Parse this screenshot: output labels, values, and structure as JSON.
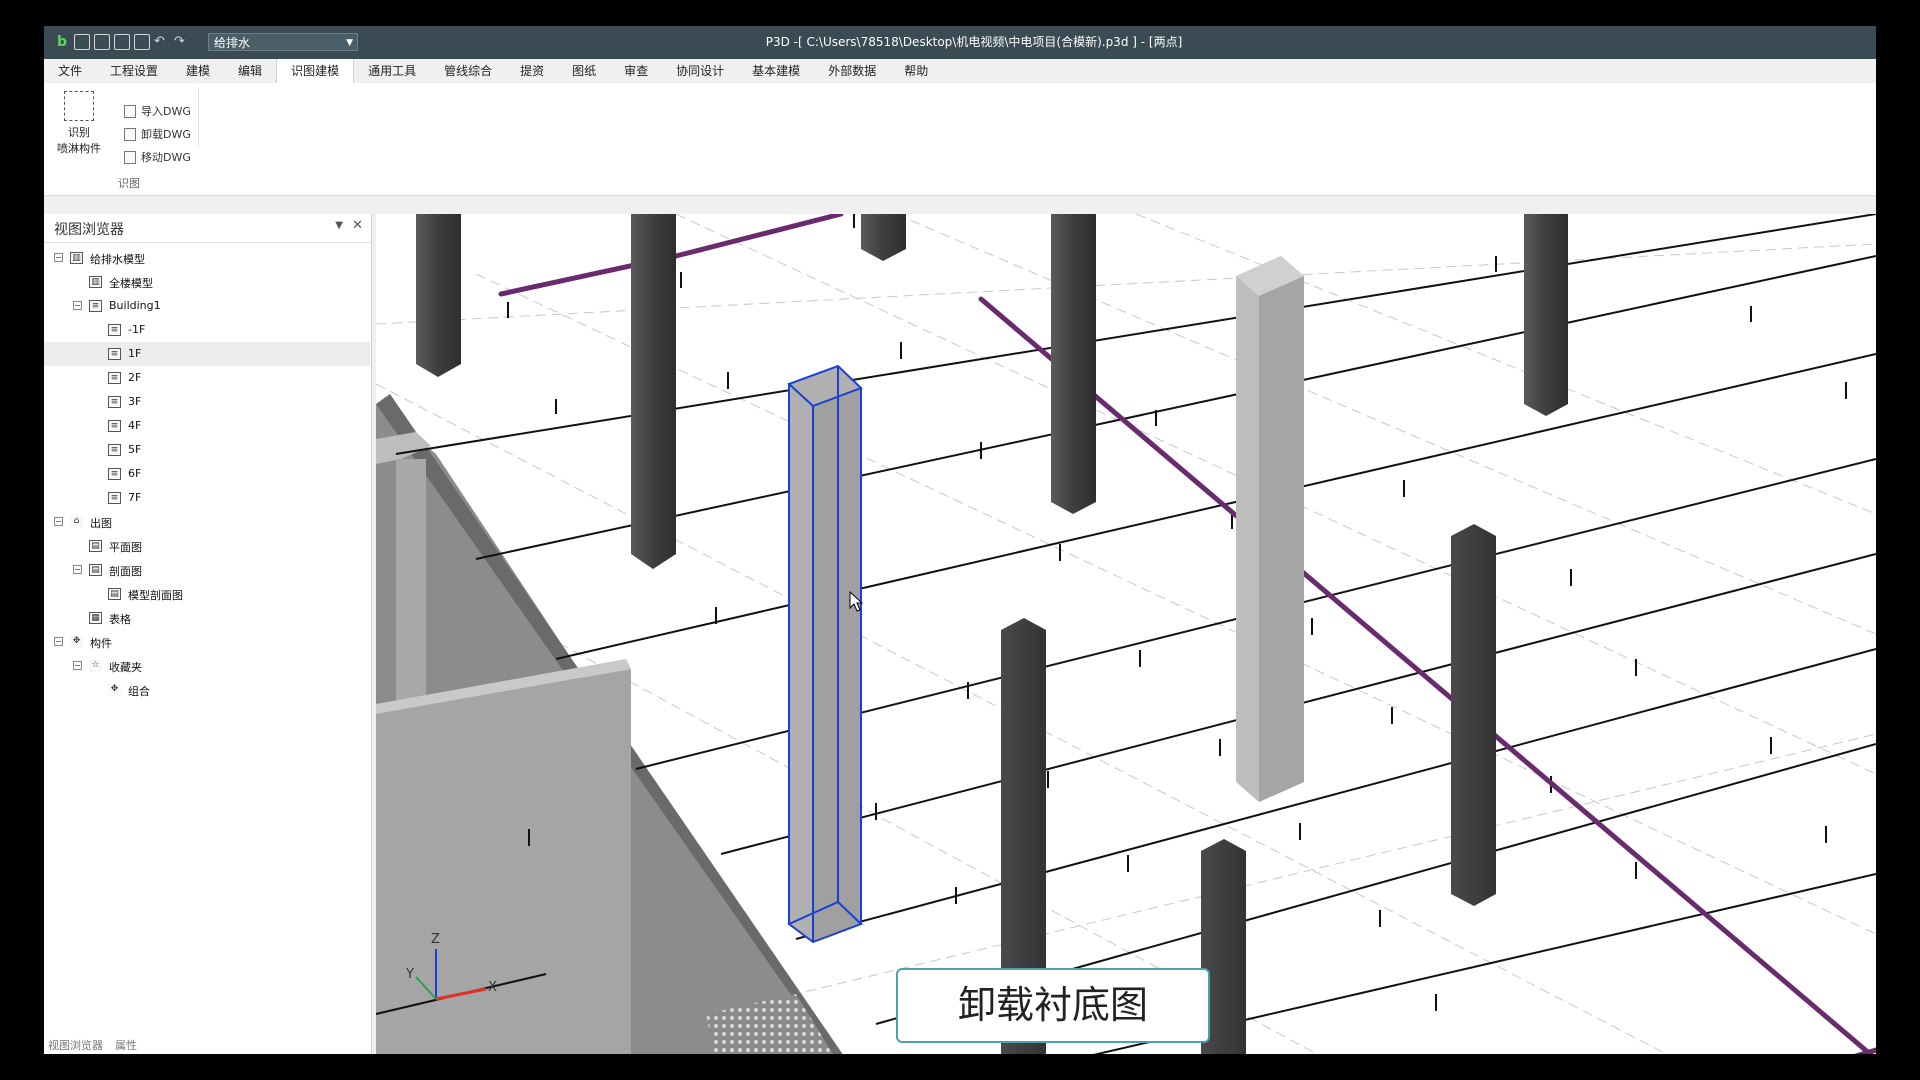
{
  "app": {
    "title": "P3D -[ C:\\Users\\78518\\Desktop\\机电视频\\中电项目(合模新).p3d ] - [两点]",
    "discipline_combo": "给排水"
  },
  "menu": {
    "items": [
      "文件",
      "工程设置",
      "建模",
      "编辑",
      "识图建模",
      "通用工具",
      "管线综合",
      "提资",
      "图纸",
      "审查",
      "协同设计",
      "基本建模",
      "外部数据",
      "帮助"
    ],
    "active_index": 4
  },
  "ribbon": {
    "big_button": {
      "line1": "识别",
      "line2": "喷淋构件",
      "icon": "sprinkler-grid-icon"
    },
    "small_buttons": [
      "导入DWG",
      "卸载DWG",
      "移动DWG"
    ],
    "group_label": "识图"
  },
  "browser": {
    "title": "视图浏览器",
    "tree": [
      {
        "label": "给排水模型",
        "level": 0,
        "toggle": "-",
        "icon": "building-icon"
      },
      {
        "label": "全楼模型",
        "level": 1,
        "toggle": "",
        "icon": "building-icon"
      },
      {
        "label": "Building1",
        "level": 1,
        "toggle": "-",
        "icon": "floor-icon"
      },
      {
        "label": "-1F",
        "level": 2,
        "toggle": "",
        "icon": "floor-icon"
      },
      {
        "label": "1F",
        "level": 2,
        "toggle": "",
        "icon": "floor-icon",
        "selected": true
      },
      {
        "label": "2F",
        "level": 2,
        "toggle": "",
        "icon": "floor-icon"
      },
      {
        "label": "3F",
        "level": 2,
        "toggle": "",
        "icon": "floor-icon"
      },
      {
        "label": "4F",
        "level": 2,
        "toggle": "",
        "icon": "floor-icon"
      },
      {
        "label": "5F",
        "level": 2,
        "toggle": "",
        "icon": "floor-icon"
      },
      {
        "label": "6F",
        "level": 2,
        "toggle": "",
        "icon": "floor-icon"
      },
      {
        "label": "7F",
        "level": 2,
        "toggle": "",
        "icon": "floor-icon"
      },
      {
        "label": "出图",
        "level": 0,
        "toggle": "-",
        "icon": "drawing-icon"
      },
      {
        "label": "平面图",
        "level": 1,
        "toggle": "",
        "icon": "sheet-icon"
      },
      {
        "label": "剖面图",
        "level": 1,
        "toggle": "-",
        "icon": "sheet-icon"
      },
      {
        "label": "模型剖面图",
        "level": 2,
        "toggle": "",
        "icon": "sheet-icon"
      },
      {
        "label": "表格",
        "level": 1,
        "toggle": "",
        "icon": "table-icon"
      },
      {
        "label": "构件",
        "level": 0,
        "toggle": "-",
        "icon": "component-icon"
      },
      {
        "label": "收藏夹",
        "level": 1,
        "toggle": "-",
        "icon": "star-icon"
      },
      {
        "label": "组合",
        "level": 2,
        "toggle": "",
        "icon": "component-icon"
      }
    ],
    "bottom_tabs": [
      "视图浏览器",
      "属性"
    ]
  },
  "viewport": {
    "axes": {
      "x": "X",
      "y": "Y",
      "z": "Z"
    },
    "colors": {
      "pipe": "#6a2a6e",
      "selection": "#1a3fd6",
      "column_dark": "#444444",
      "column_light": "#bcbcbc"
    }
  },
  "caption": "卸载衬底图"
}
